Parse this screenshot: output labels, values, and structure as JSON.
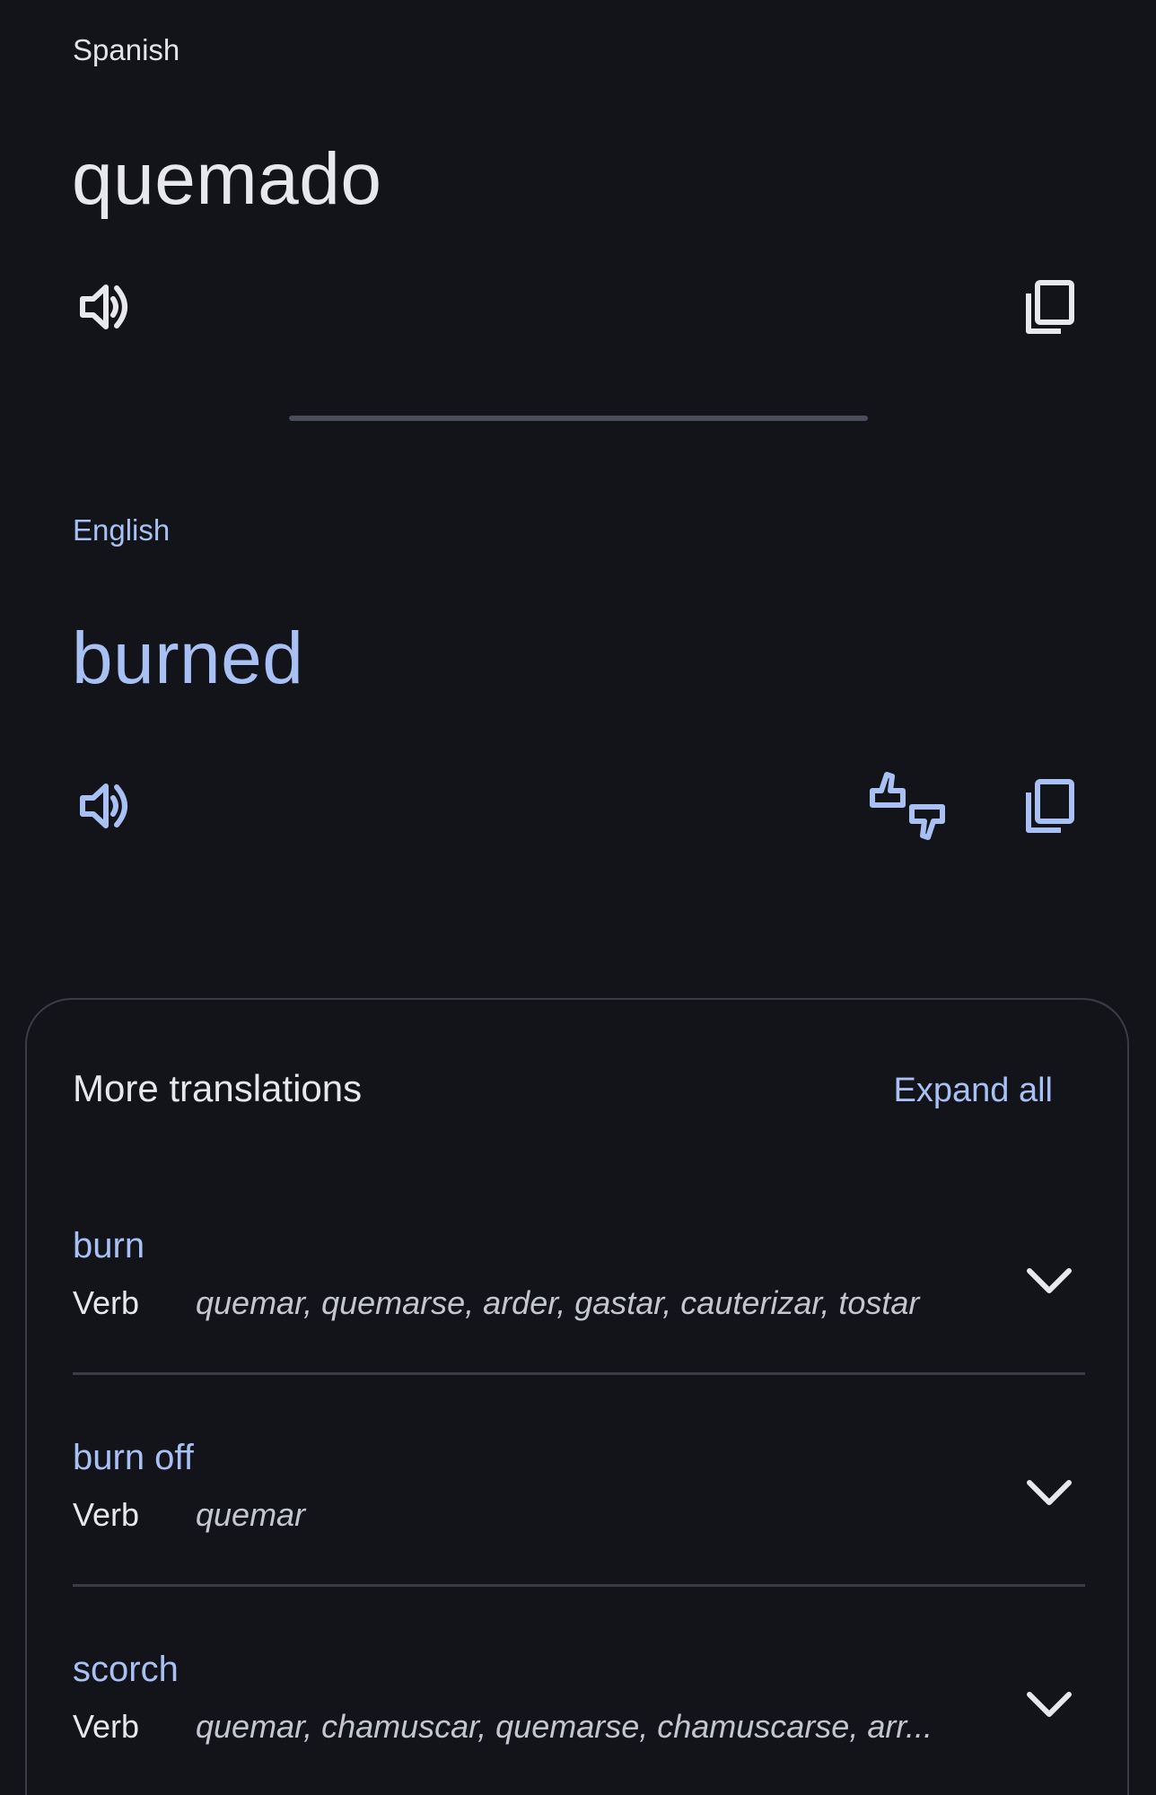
{
  "source": {
    "language": "Spanish",
    "text": "quemado"
  },
  "target": {
    "language": "English",
    "text": "burned"
  },
  "icons": {
    "speaker": "speaker-icon",
    "copy": "copy-icon",
    "rate": "thumbs-rating-icon",
    "expand": "chevron-down-icon"
  },
  "colors": {
    "background": "#131419",
    "accent": "#a9c0f5",
    "text": "#e8e8ec",
    "divider": "#3a3d48"
  },
  "more_translations": {
    "title": "More translations",
    "expand_all_label": "Expand all",
    "entries": [
      {
        "term": "burn",
        "part_of_speech": "Verb",
        "synonyms": "quemar, quemarse, arder, gastar, cauterizar, tostar"
      },
      {
        "term": "burn off",
        "part_of_speech": "Verb",
        "synonyms": "quemar"
      },
      {
        "term": "scorch",
        "part_of_speech": "Verb",
        "synonyms": "quemar, chamuscar, quemarse, chamuscarse, arr..."
      }
    ]
  }
}
